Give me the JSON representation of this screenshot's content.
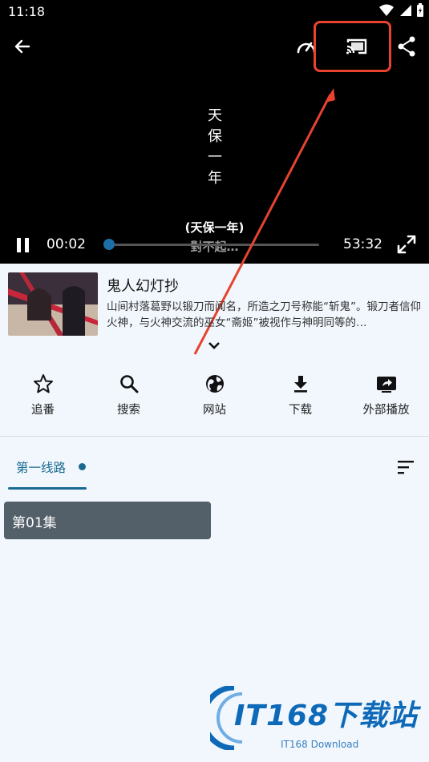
{
  "status": {
    "time": "11:18"
  },
  "player": {
    "vertical_title": [
      "天",
      "保",
      "一",
      "年"
    ],
    "subtitle_line1": "(天保一年)",
    "subtitle_line2": "對不起…",
    "current_time": "00:02",
    "total_time": "53:32",
    "progress_fraction": 0.005
  },
  "show": {
    "title": "鬼人幻灯抄",
    "description": "山间村落葛野以锻刀而闻名，所造之刀号称能“斩鬼”。锻刀者信仰火神，与火神交流的巫女“斋姬”被视作与神明同等的…"
  },
  "actions": [
    {
      "label": "追番",
      "icon": "star-icon"
    },
    {
      "label": "搜索",
      "icon": "search-icon"
    },
    {
      "label": "网站",
      "icon": "globe-icon"
    },
    {
      "label": "下载",
      "icon": "download-icon"
    },
    {
      "label": "外部播放",
      "icon": "external-play-icon"
    }
  ],
  "tabs": [
    {
      "label": "第一线路"
    }
  ],
  "episodes": [
    {
      "label": "第01集"
    }
  ],
  "watermark": {
    "main": "IT168下载站",
    "sub": "IT168 Download"
  },
  "colors": {
    "accent": "#1a6a90",
    "highlight": "#e8432f",
    "episode_bg": "#535f69"
  }
}
